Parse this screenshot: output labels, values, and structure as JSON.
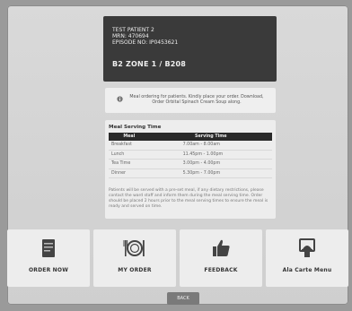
{
  "patient": {
    "lines": [
      "TEST PATIENT 2",
      "MRN: 470694",
      "EPISODE NO: IP0453621"
    ],
    "location": "B2 ZONE 1 / B208"
  },
  "notice": {
    "icon": "info-icon",
    "text": "Meal ordering for patients. Kindly place your order. Download, Order Orbital Spinach Cream Soup along."
  },
  "serving_times": {
    "title": "Meal Serving Time",
    "headers": [
      "Meal",
      "Serving Time"
    ],
    "rows": [
      {
        "meal": "Breakfast",
        "time": "7.00am - 8.00am"
      },
      {
        "meal": "Lunch",
        "time": "11.45pm - 1.00pm"
      },
      {
        "meal": "Tea Time",
        "time": "3.00pm - 4.00pm"
      },
      {
        "meal": "Dinner",
        "time": "5.30pm - 7.00pm"
      }
    ],
    "note": "Patients will be served with a pre-set meal, if any dietary restrictions, please contact the ward staff and inform them during the meal serving time. Order should be placed 2 hours prior to the meal serving times to ensure the meal is ready and served on time."
  },
  "tiles": [
    {
      "label": "ORDER NOW",
      "icon": "menu-book-icon"
    },
    {
      "label": "MY ORDER",
      "icon": "plate-cutlery-icon"
    },
    {
      "label": "FEEDBACK",
      "icon": "thumbs-up-icon"
    },
    {
      "label": "Ala Carte Menu",
      "icon": "room-service-icon"
    }
  ],
  "back_label": "BACK",
  "colors": {
    "card_bg": "#3a3a3a",
    "tile_bg": "#ededed",
    "page_bg": "#d9d9d9",
    "button_bg": "#7a7a7a"
  }
}
